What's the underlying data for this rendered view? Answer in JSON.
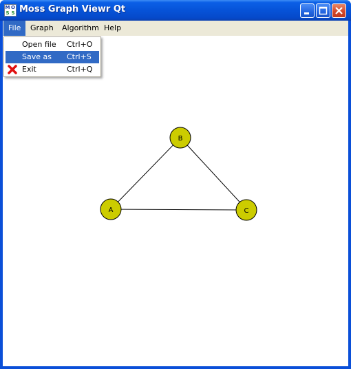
{
  "window": {
    "title": "Moss Graph Viewr Qt",
    "app_icon_letters": [
      "M",
      "O",
      "S",
      "S"
    ]
  },
  "menubar": {
    "items": [
      {
        "label": "File",
        "active": true
      },
      {
        "label": "Graph",
        "active": false
      },
      {
        "label": "Algorithm",
        "active": false
      },
      {
        "label": "Help",
        "active": false
      }
    ]
  },
  "file_menu": {
    "items": [
      {
        "label": "Open file",
        "shortcut": "Ctrl+O",
        "icon": null,
        "highlighted": false
      },
      {
        "label": "Save as",
        "shortcut": "Ctrl+S",
        "icon": null,
        "highlighted": true
      },
      {
        "label": "Exit",
        "shortcut": "Ctrl+Q",
        "icon": "red-x-icon",
        "highlighted": false
      }
    ]
  },
  "graph": {
    "node_color": "#cccc00",
    "nodes": [
      {
        "id": "A",
        "label": "A"
      },
      {
        "id": "B",
        "label": "B"
      },
      {
        "id": "C",
        "label": "C"
      }
    ],
    "edges": [
      {
        "from": "A",
        "to": "B"
      },
      {
        "from": "B",
        "to": "C"
      },
      {
        "from": "A",
        "to": "C"
      }
    ]
  },
  "colors": {
    "titlebar_blue": "#0653d8",
    "menu_highlight": "#316ac5",
    "menubar_bg": "#ece9d8"
  }
}
